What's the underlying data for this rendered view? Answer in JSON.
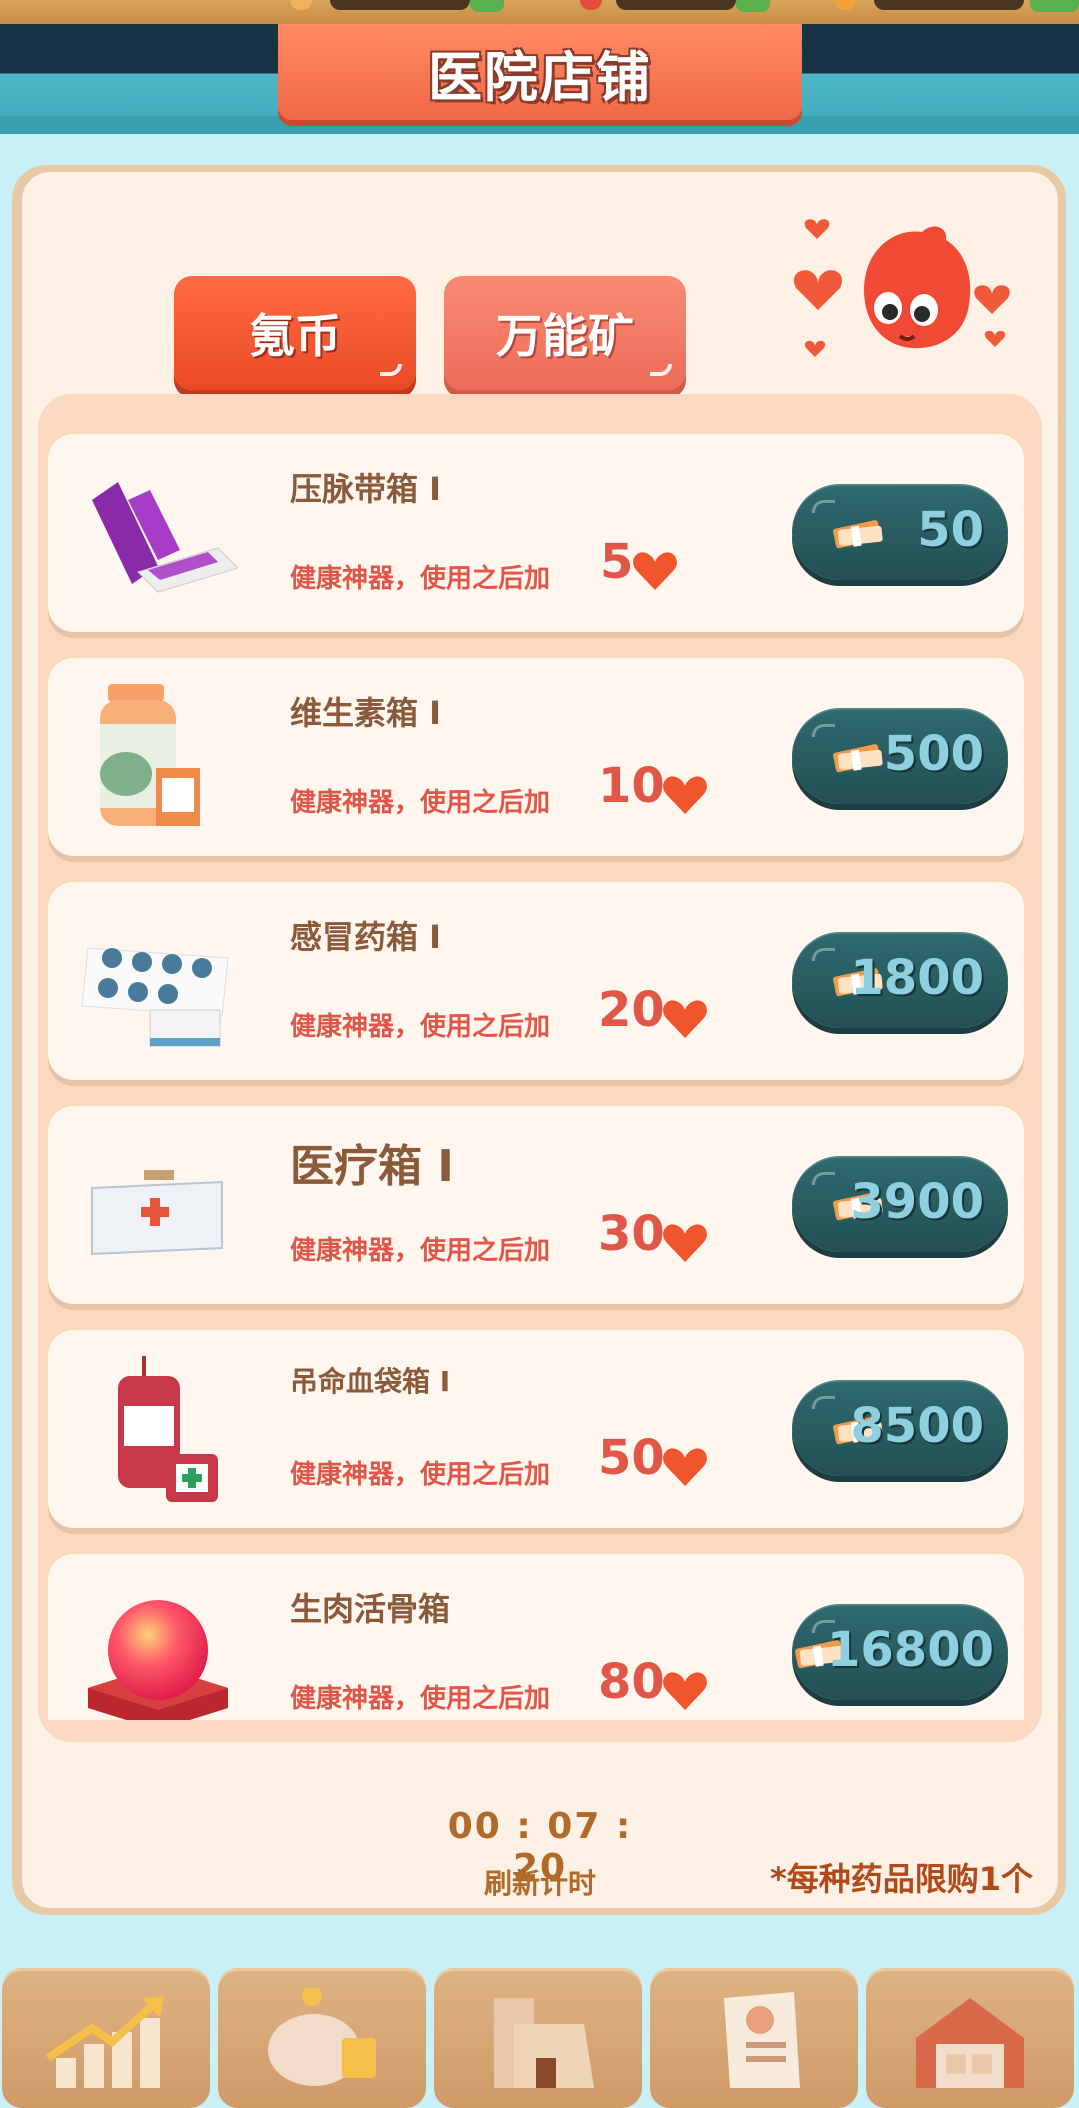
{
  "title": "医院店铺",
  "tabs": [
    {
      "label": "氪币",
      "active": true
    },
    {
      "label": "万能矿",
      "active": false
    }
  ],
  "items": [
    {
      "name": "压脉带箱 I",
      "desc": "健康神器，使用之后加",
      "amount": "5",
      "price": "50",
      "icon": "tourniquet-icon"
    },
    {
      "name": "维生素箱 I",
      "desc": "健康神器，使用之后加",
      "amount": "10",
      "price": "500",
      "icon": "vitamin-bottle-icon"
    },
    {
      "name": "感冒药箱 I",
      "desc": "健康神器，使用之后加",
      "amount": "20",
      "price": "1800",
      "icon": "cold-pills-icon"
    },
    {
      "name": "医疗箱 I",
      "desc": "健康神器，使用之后加",
      "amount": "30",
      "price": "3900",
      "icon": "medical-kit-icon"
    },
    {
      "name": "吊命血袋箱 I",
      "desc": "健康神器，使用之后加",
      "amount": "50",
      "price": "8500",
      "icon": "blood-bag-icon"
    },
    {
      "name": "生肉活骨箱",
      "desc": "健康神器，使用之后加",
      "amount": "80",
      "price": "16800",
      "icon": "orb-icon"
    }
  ],
  "timer": {
    "value": "00 : 07 : 20",
    "label": "刷新计时"
  },
  "limit_note": "*每种药品限购1个",
  "nav": [
    {
      "icon": "growth-chart-icon"
    },
    {
      "icon": "piggy-bank-icon"
    },
    {
      "icon": "hospital-building-icon"
    },
    {
      "icon": "profile-document-icon"
    },
    {
      "icon": "warehouse-icon"
    }
  ],
  "colors": {
    "accent": "#f06846",
    "button": "#224f55",
    "price_text": "#8fd0e0",
    "desc_text": "#e0574a"
  }
}
